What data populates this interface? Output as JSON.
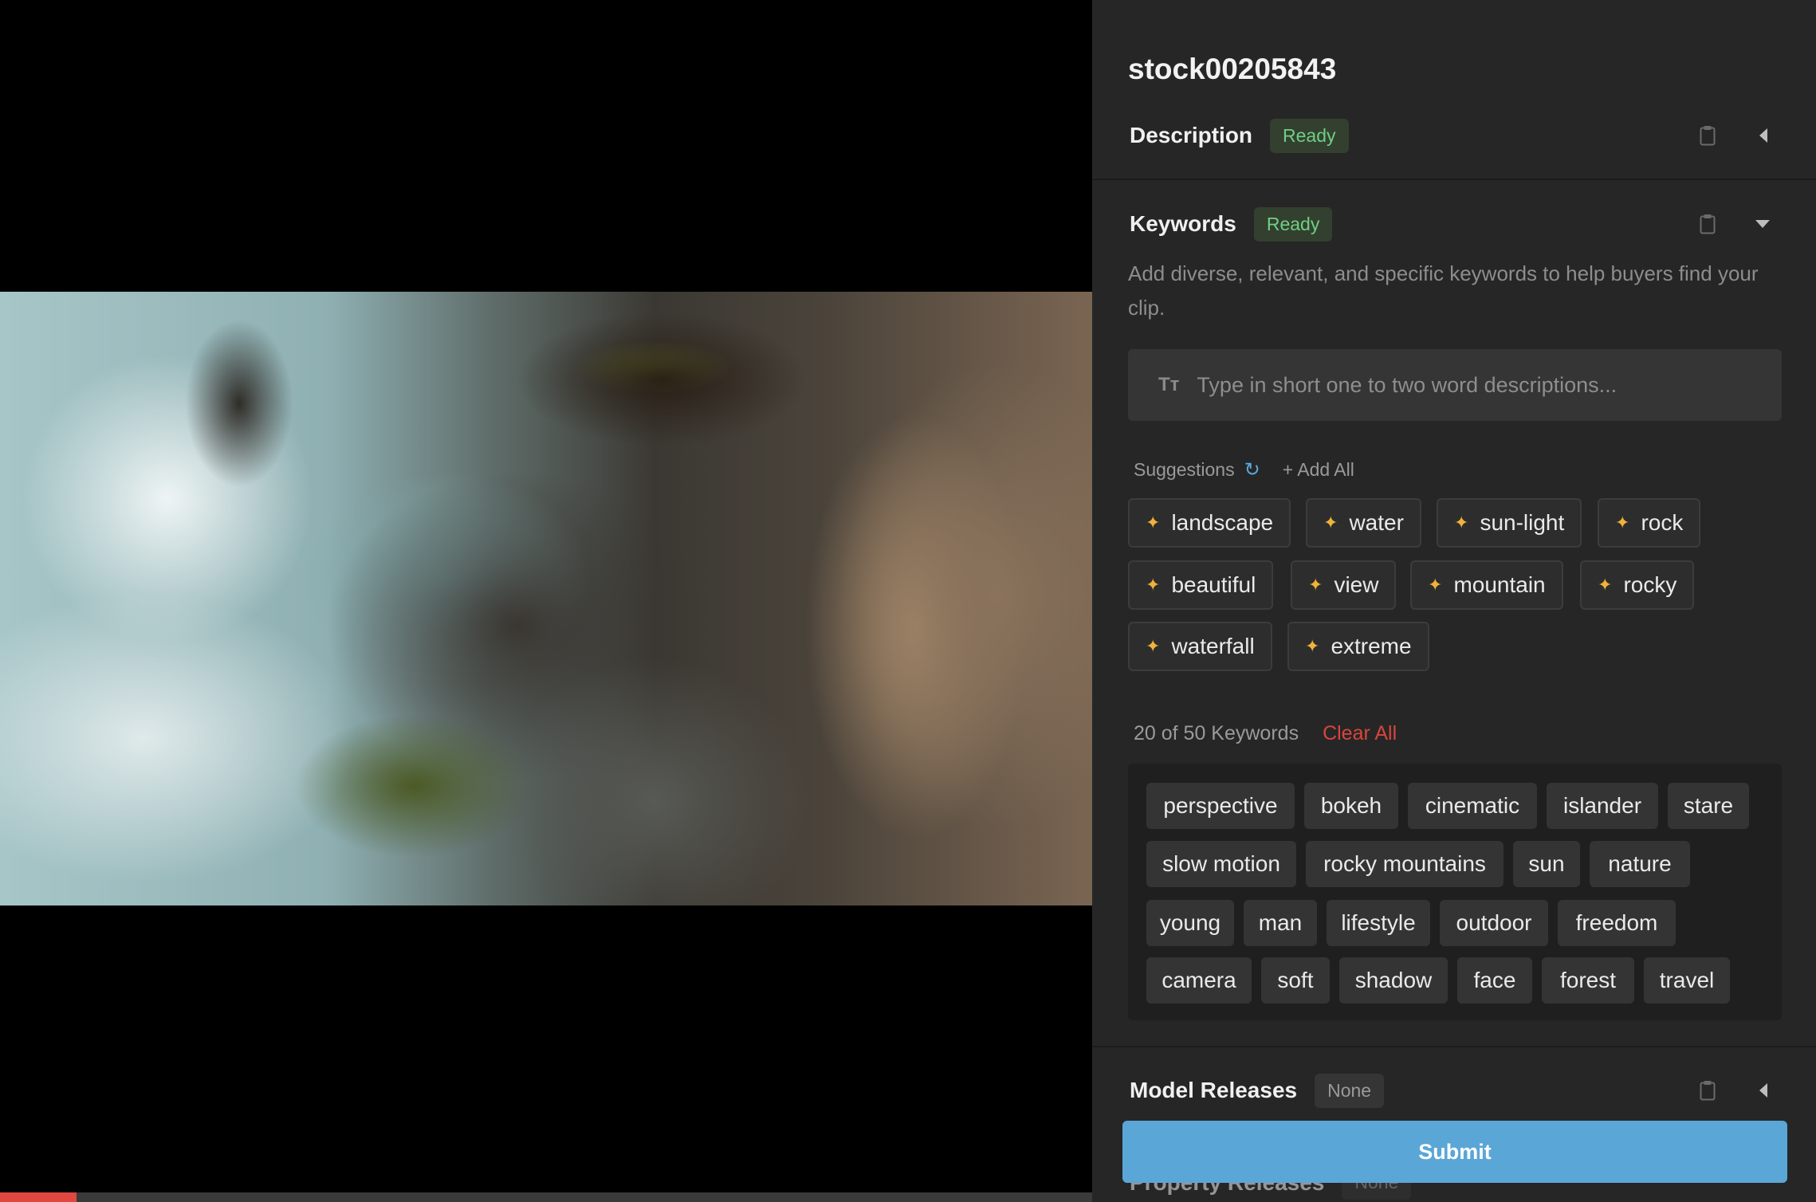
{
  "clip": {
    "title": "stock00205843"
  },
  "description": {
    "title": "Description",
    "status": "Ready"
  },
  "keywords": {
    "title": "Keywords",
    "status": "Ready",
    "helper": "Add diverse, relevant, and specific keywords to help buyers find your clip.",
    "input_placeholder": "Type in short one to two word descriptions...",
    "input_icon": "Tт",
    "suggestions_label": "Suggestions",
    "add_all_label": "+ Add All",
    "suggestions": [
      "landscape",
      "water",
      "sun-light",
      "rock",
      "beautiful",
      "view",
      "mountain",
      "rocky",
      "waterfall",
      "extreme"
    ],
    "count_label": "20 of 50 Keywords",
    "clear_all_label": "Clear All",
    "selected": [
      "perspective",
      "bokeh",
      "cinematic",
      "islander",
      "stare",
      "slow motion",
      "rocky mountains",
      "sun",
      "nature",
      "young",
      "man",
      "lifestyle",
      "outdoor",
      "freedom",
      "camera",
      "soft",
      "shadow",
      "face",
      "forest",
      "travel"
    ]
  },
  "model_releases": {
    "title": "Model Releases",
    "status": "None"
  },
  "property_releases": {
    "title": "Property Releases",
    "status": "None"
  },
  "submit_label": "Submit",
  "video": {
    "progress": 0.07
  },
  "colors": {
    "accent": "#5aa6d6",
    "ready": "#6fcf83",
    "danger": "#d9453d",
    "spark": "#f0b23a"
  }
}
